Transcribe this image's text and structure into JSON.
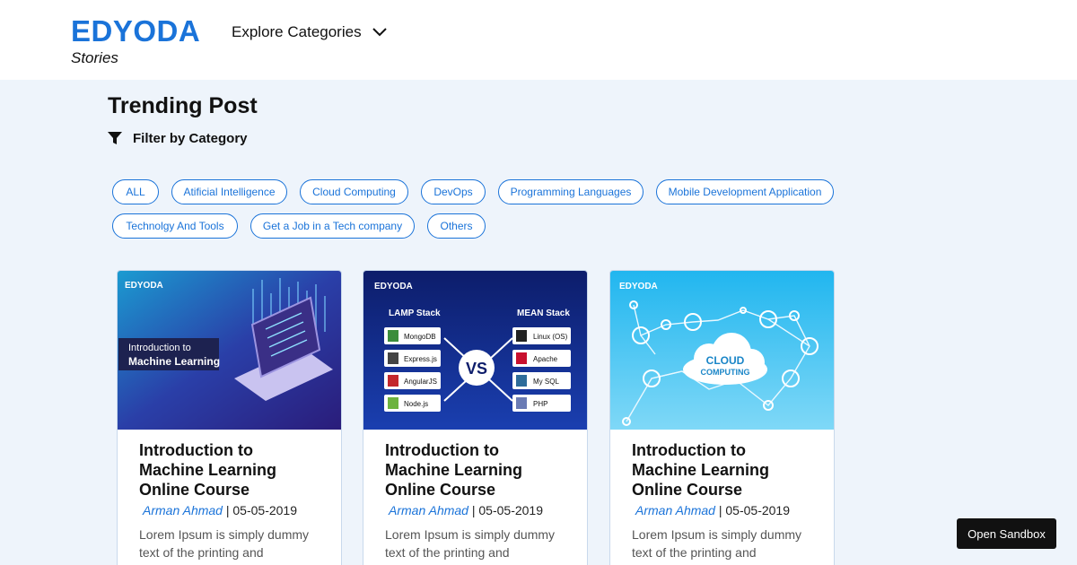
{
  "header": {
    "logo_title": "EDYODA",
    "logo_subtitle": "Stories",
    "explore_label": "Explore Categories",
    "explore_icon": "chevron-down-icon"
  },
  "main": {
    "section_title": "Trending Post",
    "filter_label": "Filter by Category",
    "filter_icon": "funnel-icon",
    "categories": [
      "ALL",
      "Atificial Intelligence",
      "Cloud Computing",
      "DevOps",
      "Programming Languages",
      "Mobile Development Application",
      "Technolgy And Tools",
      "Get a Job in a Tech company",
      "Others"
    ],
    "posts": [
      {
        "image": {
          "brand": "EDYODA",
          "caption_line1": "Introduction to",
          "caption_line2": "Machine Learning"
        },
        "title": "Introduction to Machine Learning Online Course",
        "author": "Arman Ahmad",
        "separator": "|",
        "date": "05-05-2019",
        "description": "Lorem Ipsum is simply dummy text of the printing and typesetting industry."
      },
      {
        "image": {
          "brand": "EDYODA",
          "left_heading": "LAMP Stack",
          "right_heading": "MEAN Stack",
          "vs": "VS",
          "left_items": [
            "MongoDB",
            "Express.js",
            "AngularJS",
            "Node.js"
          ],
          "right_items": [
            "Linux (OS)",
            "Apache",
            "My SQL",
            "PHP"
          ]
        },
        "title": "Introduction to Machine Learning Online Course",
        "author": "Arman Ahmad",
        "separator": "|",
        "date": "05-05-2019",
        "description": "Lorem Ipsum is simply dummy text of the printing and typesetting industry."
      },
      {
        "image": {
          "brand": "EDYODA",
          "cloud_line1": "CLOUD",
          "cloud_line2": "COMPUTING"
        },
        "title": "Introduction to Machine Learning Online Course",
        "author": "Arman Ahmad",
        "separator": "|",
        "date": "05-05-2019",
        "description": "Lorem Ipsum is simply dummy text of the printing and typesetting industry."
      }
    ]
  },
  "sandbox_label": "Open Sandbox",
  "colors": {
    "brand": "#1a73d9",
    "page_bg": "#eef4fb",
    "card_border": "#c9d9ec"
  }
}
